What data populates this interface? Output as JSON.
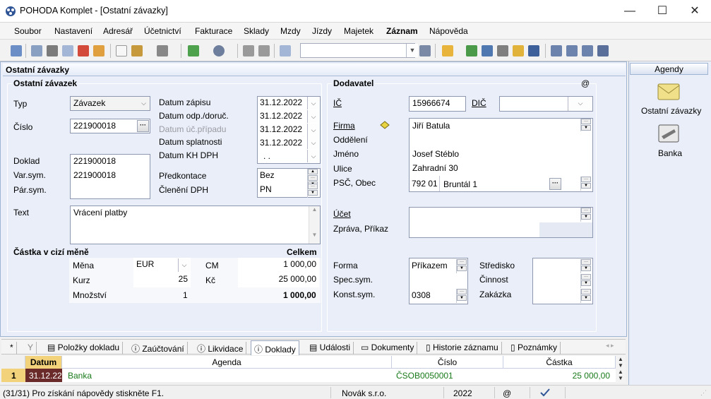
{
  "window": {
    "title": "POHODA Komplet - [Ostatní závazky]",
    "minimize": "—",
    "maximize": "☐",
    "close": "✕"
  },
  "menu": [
    "Soubor",
    "Nastavení",
    "Adresář",
    "Účetnictví",
    "Fakturace",
    "Sklady",
    "Mzdy",
    "Jízdy",
    "Majetek",
    "Záznam",
    "Nápověda"
  ],
  "page_title": "Ostatní závazky",
  "left_group": {
    "title": "Ostatní závazek",
    "typ_label": "Typ",
    "typ_value": "Závazek",
    "cislo_label": "Číslo",
    "cislo_value": "221900018",
    "doklad_label": "Doklad",
    "doklad_value": "221900018",
    "varsym_label": "Var.sym.",
    "varsym_value": "221900018",
    "parsym_label": "Pár.sym.",
    "parsym_value": "",
    "text_label": "Text",
    "text_value": "Vrácení platby",
    "datum_zapisu_label": "Datum zápisu",
    "datum_zapisu": "31.12.2022",
    "datum_odp_label": "Datum odp./doruč.",
    "datum_odp": "31.12.2022",
    "datum_uc_label": "Datum úč.případu",
    "datum_uc": "31.12.2022",
    "datum_splat_label": "Datum splatnosti",
    "datum_splat": "31.12.2022",
    "datum_kh_label": "Datum KH DPH",
    "datum_kh": ". .",
    "predkontace_label": "Předkontace",
    "predkontace": "Bez",
    "cleneni_label": "Členění DPH",
    "cleneni": "PN"
  },
  "foreign": {
    "title": "Částka v cizí měně",
    "total_label": "Celkem",
    "mena_label": "Měna",
    "mena": "EUR",
    "kurz_label": "Kurz",
    "kurz": "25",
    "mnozstvi_label": "Množství",
    "mnozstvi": "1",
    "cm_label": "CM",
    "cm": "1 000,00",
    "kc_label": "Kč",
    "kc": "25 000,00",
    "celkem": "1 000,00"
  },
  "supplier": {
    "title": "Dodavatel",
    "at": "@",
    "ic_label": "IČ",
    "ic": "15966674",
    "dic_label": "DIČ",
    "dic": "",
    "firma_label": "Firma",
    "firma": "Jiří Batula",
    "oddeleni_label": "Oddělení",
    "oddeleni": "",
    "jmeno_label": "Jméno",
    "jmeno": "Josef Stéblo",
    "ulice_label": "Ulice",
    "ulice": "Zahradní 30",
    "psc_label": "PSČ, Obec",
    "psc": "792 01",
    "obec": "Bruntál 1",
    "ucet_label": "Účet",
    "ucet": "",
    "zprava_label": "Zpráva, Příkaz",
    "forma_label": "Forma",
    "forma": "Příkazem",
    "specsym_label": "Spec.sym.",
    "specsym": "",
    "konstsym_label": "Konst.sym.",
    "konstsym": "0308",
    "stredisko_label": "Středisko",
    "cinnost_label": "Činnost",
    "zakazka_label": "Zakázka"
  },
  "agenda_panel": {
    "title": "Agendy",
    "items": [
      "Ostatní závazky",
      "Banka"
    ]
  },
  "tabs": [
    "*",
    "Y",
    "Položky dokladu",
    "Zaúčtování",
    "Likvidace",
    "Doklady",
    "Události",
    "Dokumenty",
    "Historie záznamu",
    "Poznámky"
  ],
  "grid": {
    "headers": [
      "Datum",
      "Agenda",
      "Číslo",
      "Částka"
    ],
    "rows": [
      {
        "num": "1",
        "datum": "31.12.22",
        "agenda": "Banka",
        "cislo": "ČSOB0050001",
        "castka": "25 000,00"
      }
    ]
  },
  "status": {
    "hint": "(31/31) Pro získání nápovědy stiskněte F1.",
    "company": "Novák s.r.o.",
    "year": "2022",
    "at": "@"
  },
  "colors": {
    "accent": "#2f5597",
    "panel": "#e9eef8",
    "row_green": "#187a1a",
    "date_bg": "#6b2a2a"
  }
}
